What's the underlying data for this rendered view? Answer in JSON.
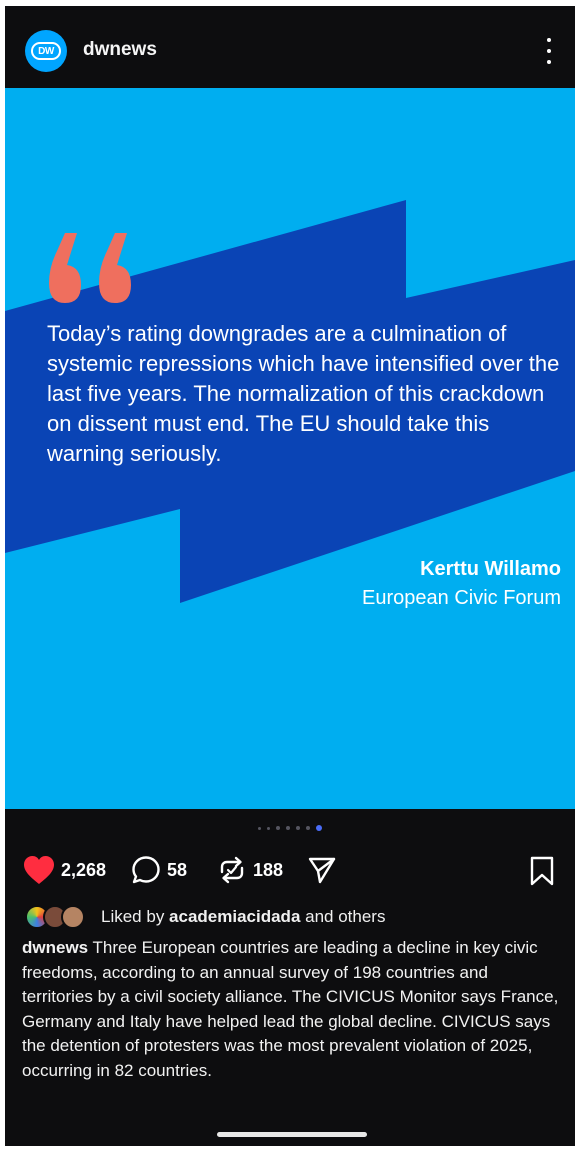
{
  "header": {
    "avatar_text": "DW",
    "username": "dwnews",
    "more_icon": "more-vertical-icon"
  },
  "post": {
    "quote_mark": "“",
    "quote": "Today’s rating downgrades are a culmination of systemic repressions which have intensified over the last five years. The normalization of this crackdown on dissent must end. The EU should take this warning seriously.",
    "author": "Kerttu Willamo",
    "organization": "European Civic Forum",
    "colors": {
      "light_blue": "#00aef0",
      "dark_blue": "#0a44b5",
      "quote_mark": "#ef6f5e"
    },
    "carousel": {
      "total": 7,
      "active": 7
    }
  },
  "actions": {
    "likes": "2,268",
    "comments": "58",
    "reposts": "188",
    "icons": [
      "heart-icon",
      "comment-icon",
      "repost-icon",
      "share-icon",
      "bookmark-icon"
    ]
  },
  "liked_by": {
    "prefix": "Liked by ",
    "user": "academiacidada",
    "suffix": " and others"
  },
  "caption": {
    "user": "dwnews",
    "text": " Three European countries are leading a decline in key civic freedoms, according to an annual survey of 198 countries and territories by a civil society alliance. The CIVICUS Monitor says France, Germany and Italy have helped lead the global decline. CIVICUS says the detention of protesters was the most prevalent violation of 2025, occurring in 82 countries."
  }
}
